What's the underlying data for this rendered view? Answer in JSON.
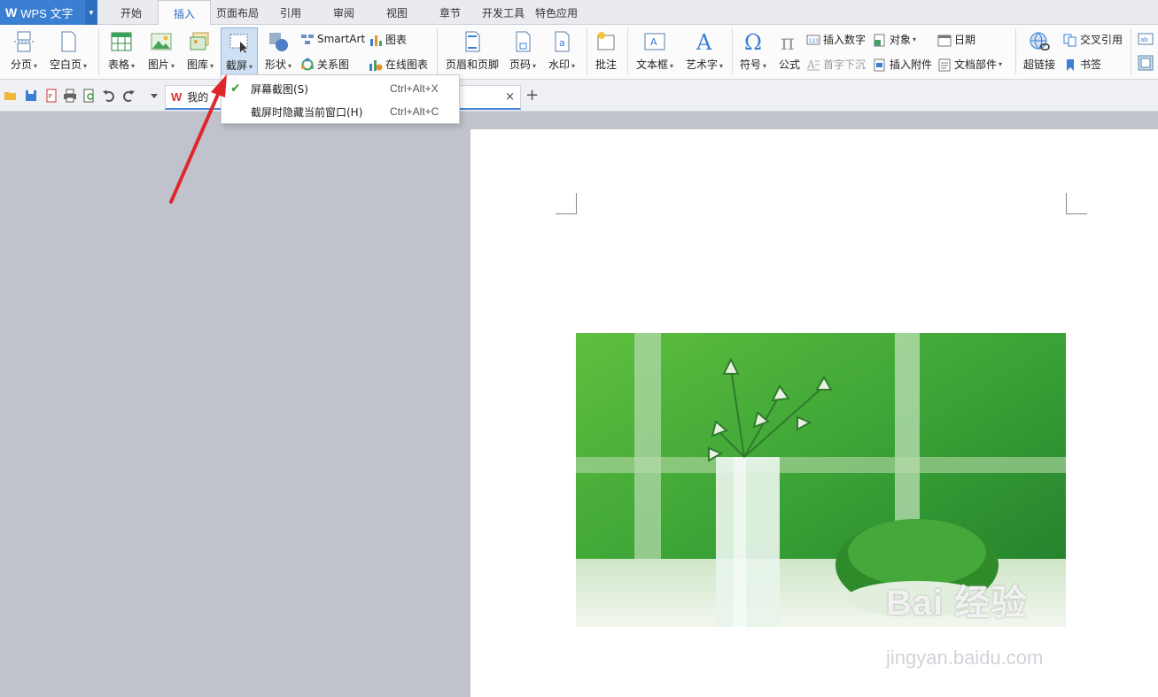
{
  "app": {
    "title": "WPS 文字",
    "logo": "W"
  },
  "tabs": [
    "开始",
    "插入",
    "页面布局",
    "引用",
    "审阅",
    "视图",
    "章节",
    "开发工具",
    "特色应用"
  ],
  "active_tab": "插入",
  "ribbon": {
    "page_break": "分页",
    "blank_page": "空白页",
    "table": "表格",
    "picture": "图片",
    "gallery": "图库",
    "screenshot": "截屏",
    "shapes": "形状",
    "smartart": "SmartArt",
    "chart": "图表",
    "relation": "关系图",
    "online_chart": "在线图表",
    "header_footer": "页眉和页脚",
    "page_number": "页码",
    "watermark": "水印",
    "comment": "批注",
    "textbox": "文本框",
    "wordart": "艺术字",
    "symbol": "符号",
    "formula": "公式",
    "insert_number": "插入数字",
    "drop_cap": "首字下沉",
    "object": "对象",
    "insert_attachment": "插入附件",
    "date": "日期",
    "doc_parts": "文档部件",
    "hyperlink": "超链接",
    "cross_ref": "交叉引用",
    "bookmark": "书签"
  },
  "doc_tab": {
    "logo": "W",
    "name": "我的",
    "close": "×"
  },
  "new_tab": "+",
  "dropdown": {
    "items": [
      {
        "label": "屏幕截图(S)",
        "shortcut": "Ctrl+Alt+X",
        "checked": true
      },
      {
        "label": "截屏时隐藏当前窗口(H)",
        "shortcut": "Ctrl+Alt+C",
        "checked": false
      }
    ],
    "check_glyph": "✔"
  },
  "watermark": {
    "brand": "Bai 经验",
    "url": "jingyan.baidu.com"
  },
  "colors": {
    "accent": "#3b7fd3",
    "arrow": "#e0262c",
    "check": "#3a9a3a"
  }
}
